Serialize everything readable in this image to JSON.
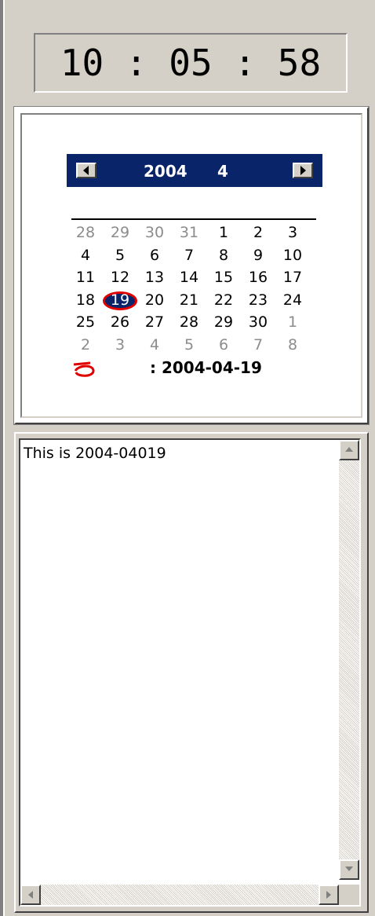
{
  "clock": {
    "time": "10 : 05 : 58"
  },
  "calendar": {
    "year": "2004",
    "month": "4",
    "prev_icon": "triangle-left-icon",
    "next_icon": "triangle-right-icon",
    "weeks": [
      [
        {
          "d": "28",
          "other": true
        },
        {
          "d": "29",
          "other": true
        },
        {
          "d": "30",
          "other": true
        },
        {
          "d": "31",
          "other": true
        },
        {
          "d": "1"
        },
        {
          "d": "2"
        },
        {
          "d": "3"
        }
      ],
      [
        {
          "d": "4"
        },
        {
          "d": "5"
        },
        {
          "d": "6"
        },
        {
          "d": "7"
        },
        {
          "d": "8"
        },
        {
          "d": "9"
        },
        {
          "d": "10"
        }
      ],
      [
        {
          "d": "11"
        },
        {
          "d": "12"
        },
        {
          "d": "13"
        },
        {
          "d": "14"
        },
        {
          "d": "15"
        },
        {
          "d": "16"
        },
        {
          "d": "17"
        }
      ],
      [
        {
          "d": "18"
        },
        {
          "d": "19",
          "today": true
        },
        {
          "d": "20"
        },
        {
          "d": "21"
        },
        {
          "d": "22"
        },
        {
          "d": "23"
        },
        {
          "d": "24"
        }
      ],
      [
        {
          "d": "25"
        },
        {
          "d": "26"
        },
        {
          "d": "27"
        },
        {
          "d": "28"
        },
        {
          "d": "29"
        },
        {
          "d": "30"
        },
        {
          "d": "1",
          "other": true
        }
      ],
      [
        {
          "d": "2",
          "other": true
        },
        {
          "d": "3",
          "other": true
        },
        {
          "d": "4",
          "other": true
        },
        {
          "d": "5",
          "other": true
        },
        {
          "d": "6",
          "other": true
        },
        {
          "d": "7",
          "other": true
        },
        {
          "d": "8",
          "other": true
        }
      ]
    ],
    "today_label": ": 2004-04-19",
    "today_mark_color": "#e00000",
    "header_color": "#0a246a"
  },
  "memo": {
    "text": "This is 2004-04019"
  }
}
